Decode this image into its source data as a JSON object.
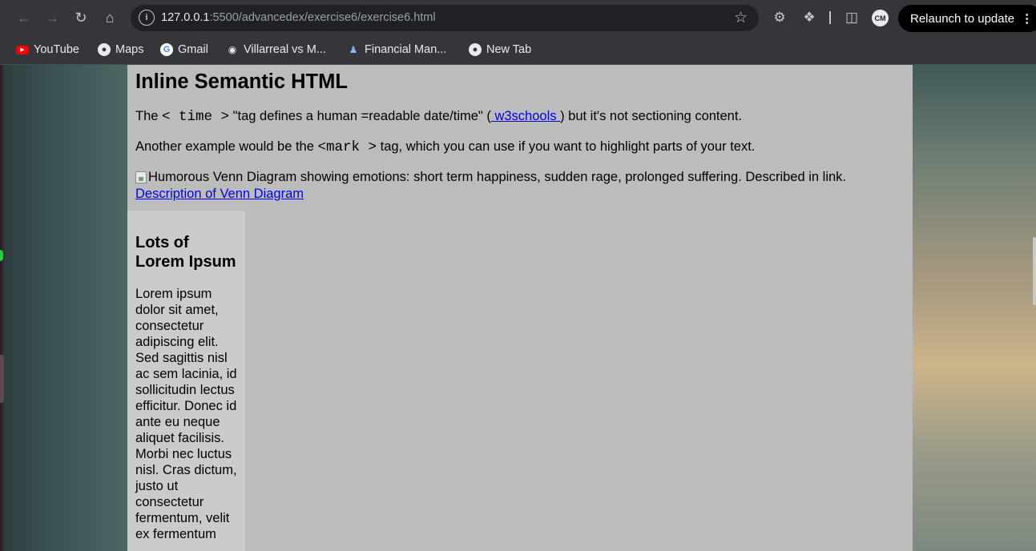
{
  "browser": {
    "url_host": "127.0.0.1",
    "url_path": ":5500/advancedex/exercise6/exercise6.html",
    "avatar_initials": "CM",
    "relaunch_label": "Relaunch to update",
    "relaunch_menu": "⋮",
    "bookmarks": [
      {
        "label": "YouTube",
        "icon": "youtube-icon"
      },
      {
        "label": "Maps",
        "icon": "globe-icon"
      },
      {
        "label": "Gmail",
        "icon": "google-icon"
      },
      {
        "label": "Villarreal vs M...",
        "icon": "club-icon"
      },
      {
        "label": "Financial Man...",
        "icon": "people-icon"
      },
      {
        "label": "New Tab",
        "icon": "globe-icon"
      }
    ]
  },
  "page": {
    "heading": "Inline Semantic HTML",
    "p1": {
      "before": "The",
      "code": "< time >",
      "middle": "\"tag defines a human =readable date/time\" (",
      "link": " w3schools ",
      "after": ") but it's not sectioning content."
    },
    "p2": {
      "before": "Another example would be the",
      "code": "<mark >",
      "after": "tag, which you can use if you want to highlight parts of your text."
    },
    "image_alt": "Humorous Venn Diagram showing emotions: short term happiness, sudden rage, prolonged suffering. Described in link.",
    "description_link": "Description of Venn Diagram",
    "aside": {
      "heading": "Lots of Lorem Ipsum",
      "body": "Lorem ipsum dolor sit amet, consectetur adipiscing elit. Sed sagittis nisl ac sem lacinia, id sollicitudin lectus efficitur. Donec id ante eu neque aliquet facilisis. Morbi nec luctus nisl. Cras dictum, justo ut consectetur fermentum, velit ex fermentum"
    }
  }
}
